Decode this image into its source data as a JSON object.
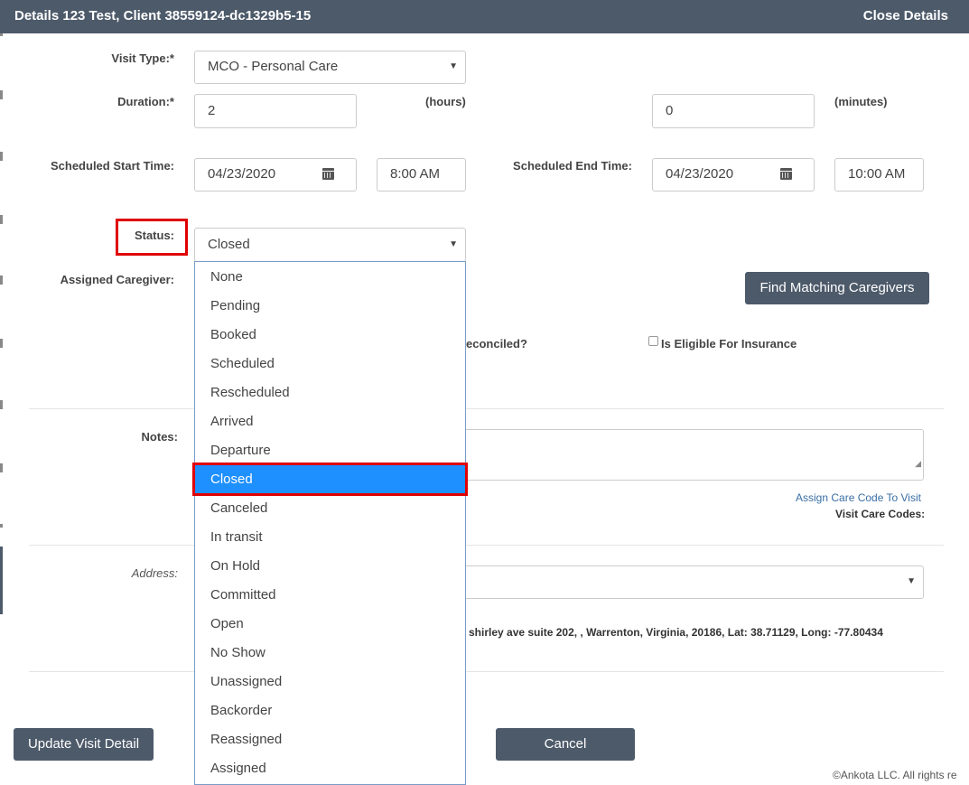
{
  "header": {
    "title": "Details 123 Test, Client 38559124-dc1329b5-15",
    "close_label": "Close Details"
  },
  "form": {
    "visit_type_label": "Visit Type:*",
    "visit_type_value": "MCO - Personal Care",
    "duration_label": "Duration:*",
    "duration_hours": "2",
    "hours_unit": "(hours)",
    "duration_minutes": "0",
    "minutes_unit": "(minutes)",
    "start_time_label": "Scheduled Start Time:",
    "start_date": "04/23/2020",
    "start_time": "8:00 AM",
    "end_time_label": "Scheduled End Time:",
    "end_date": "04/23/2020",
    "end_time": "10:00 AM",
    "status_label": "Status:",
    "status_value": "Closed",
    "assigned_caregiver_label": "Assigned Caregiver:",
    "find_caregivers_label": "Find Matching Caregivers",
    "reconciled_partial": "econciled?",
    "eligible_insurance_label": "Is Eligible For Insurance",
    "notes_label": "Notes:",
    "assign_care_code_link": "Assign Care Code To Visit",
    "visit_care_codes_label": "Visit Care Codes:",
    "address_label": "Address:",
    "address_text": "shirley ave suite 202, , Warrenton, Virginia, 20186, Lat: 38.71129, Long: -77.80434"
  },
  "status_options": [
    "None",
    "Pending",
    "Booked",
    "Scheduled",
    "Rescheduled",
    "Arrived",
    "Departure",
    "Closed",
    "Canceled",
    "In transit",
    "On Hold",
    "Committed",
    "Open",
    "No Show",
    "Unassigned",
    "Backorder",
    "Reassigned",
    "Assigned"
  ],
  "footer": {
    "update_label": "Update Visit Detail",
    "cancel_label": "Cancel",
    "copyright": "©Ankota LLC. All rights re"
  },
  "colors": {
    "header_bg": "#4d5a6a",
    "selected_option": "#1e90ff",
    "highlight_box": "#e00000"
  }
}
